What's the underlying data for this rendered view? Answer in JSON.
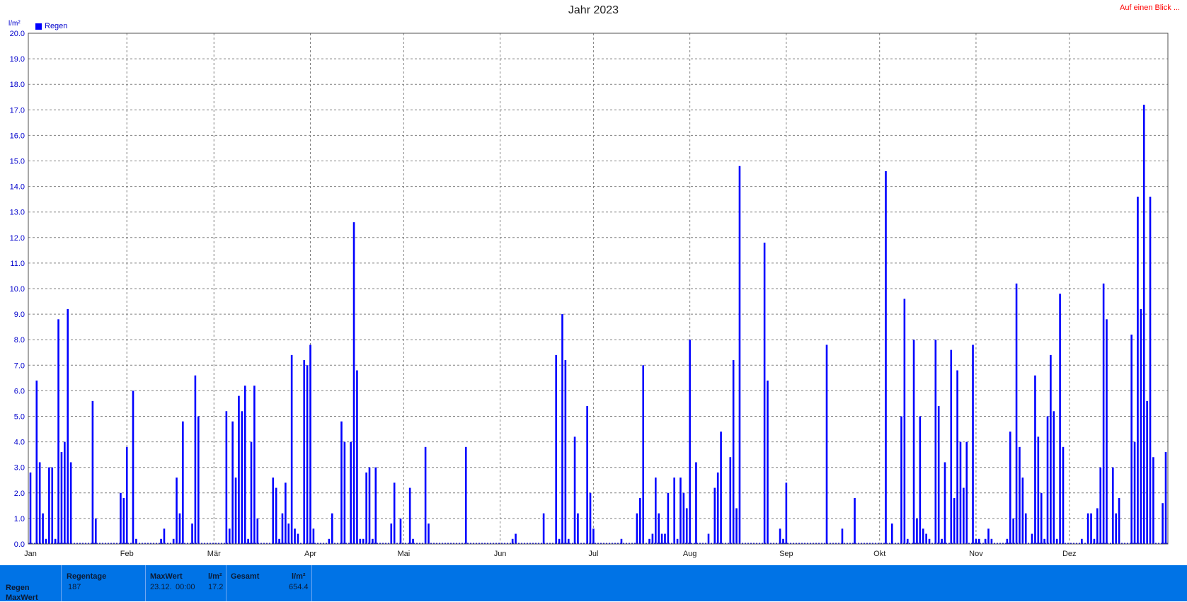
{
  "title": "Jahr 2023",
  "top_link": "Auf einen Blick ...",
  "legend_label": "Regen",
  "y_unit": "l/m²",
  "colors": {
    "bar": "#0000ff",
    "axis_text": "#0000cc",
    "footer_bg": "#0073e6",
    "link": "#ff0000"
  },
  "footer": {
    "row_labels": [
      "Regen",
      "MaxWert"
    ],
    "regentage": {
      "header": "Regentage",
      "value": "187"
    },
    "maxwert": {
      "header": "MaxWert",
      "unit": "l/m²",
      "date": "23.12.",
      "time": "00:00",
      "value": "17.2"
    },
    "gesamt": {
      "header": "Gesamt",
      "unit": "l/m²",
      "value": "654.4"
    }
  },
  "chart_data": {
    "type": "bar",
    "title": "Jahr 2023",
    "ylabel": "l/m²",
    "ylim": [
      0,
      20
    ],
    "yticks": [
      "0.0",
      "1.0",
      "2.0",
      "3.0",
      "4.0",
      "5.0",
      "6.0",
      "7.0",
      "8.0",
      "9.0",
      "10.0",
      "11.0",
      "12.0",
      "13.0",
      "14.0",
      "15.0",
      "16.0",
      "17.0",
      "18.0",
      "19.0",
      "20.0"
    ],
    "xticks": [
      {
        "label": "Jan",
        "day": 1
      },
      {
        "label": "Feb",
        "day": 32
      },
      {
        "label": "Mär",
        "day": 60
      },
      {
        "label": "Apr",
        "day": 91
      },
      {
        "label": "Mai",
        "day": 121
      },
      {
        "label": "Jun",
        "day": 152
      },
      {
        "label": "Jul",
        "day": 182
      },
      {
        "label": "Aug",
        "day": 213
      },
      {
        "label": "Sep",
        "day": 244
      },
      {
        "label": "Okt",
        "day": 274
      },
      {
        "label": "Nov",
        "day": 305
      },
      {
        "label": "Dez",
        "day": 335
      }
    ],
    "x_domain": [
      1,
      366
    ],
    "grid": true,
    "legend": "top-left",
    "series": [
      {
        "name": "Regen",
        "points": [
          [
            1,
            2.8
          ],
          [
            3,
            6.4
          ],
          [
            4,
            3.2
          ],
          [
            5,
            1.2
          ],
          [
            6,
            0.2
          ],
          [
            7,
            3.0
          ],
          [
            8,
            3.0
          ],
          [
            9,
            0.2
          ],
          [
            10,
            8.8
          ],
          [
            11,
            3.6
          ],
          [
            12,
            4.0
          ],
          [
            13,
            9.2
          ],
          [
            14,
            3.2
          ],
          [
            21,
            5.6
          ],
          [
            22,
            1.0
          ],
          [
            30,
            2.0
          ],
          [
            31,
            1.8
          ],
          [
            32,
            3.8
          ],
          [
            34,
            6.0
          ],
          [
            35,
            0.2
          ],
          [
            43,
            0.2
          ],
          [
            44,
            0.6
          ],
          [
            47,
            0.2
          ],
          [
            48,
            2.6
          ],
          [
            49,
            1.2
          ],
          [
            50,
            4.8
          ],
          [
            53,
            0.8
          ],
          [
            54,
            6.6
          ],
          [
            55,
            5.0
          ],
          [
            64,
            5.2
          ],
          [
            65,
            0.6
          ],
          [
            66,
            4.8
          ],
          [
            67,
            2.6
          ],
          [
            68,
            5.8
          ],
          [
            69,
            5.2
          ],
          [
            70,
            6.2
          ],
          [
            71,
            0.2
          ],
          [
            72,
            4.0
          ],
          [
            73,
            6.2
          ],
          [
            74,
            1.0
          ],
          [
            79,
            2.6
          ],
          [
            80,
            2.2
          ],
          [
            81,
            0.2
          ],
          [
            82,
            1.2
          ],
          [
            83,
            2.4
          ],
          [
            84,
            0.8
          ],
          [
            85,
            7.4
          ],
          [
            86,
            0.6
          ],
          [
            87,
            0.4
          ],
          [
            89,
            7.2
          ],
          [
            90,
            7.0
          ],
          [
            91,
            7.8
          ],
          [
            92,
            0.6
          ],
          [
            97,
            0.2
          ],
          [
            98,
            1.2
          ],
          [
            101,
            4.8
          ],
          [
            102,
            4.0
          ],
          [
            104,
            4.0
          ],
          [
            105,
            12.6
          ],
          [
            106,
            6.8
          ],
          [
            107,
            0.2
          ],
          [
            108,
            0.2
          ],
          [
            109,
            2.8
          ],
          [
            110,
            3.0
          ],
          [
            111,
            0.2
          ],
          [
            112,
            3.0
          ],
          [
            117,
            0.8
          ],
          [
            118,
            2.4
          ],
          [
            120,
            1.0
          ],
          [
            123,
            2.2
          ],
          [
            124,
            0.2
          ],
          [
            128,
            3.8
          ],
          [
            129,
            0.8
          ],
          [
            141,
            3.8
          ],
          [
            156,
            0.2
          ],
          [
            157,
            0.4
          ],
          [
            166,
            1.2
          ],
          [
            170,
            7.4
          ],
          [
            171,
            0.2
          ],
          [
            172,
            9.0
          ],
          [
            173,
            7.2
          ],
          [
            174,
            0.2
          ],
          [
            176,
            4.2
          ],
          [
            177,
            1.2
          ],
          [
            180,
            5.4
          ],
          [
            181,
            2.0
          ],
          [
            182,
            0.6
          ],
          [
            191,
            0.2
          ],
          [
            196,
            1.2
          ],
          [
            197,
            1.8
          ],
          [
            198,
            7.0
          ],
          [
            200,
            0.2
          ],
          [
            201,
            0.4
          ],
          [
            202,
            2.6
          ],
          [
            203,
            1.2
          ],
          [
            204,
            0.4
          ],
          [
            205,
            0.4
          ],
          [
            206,
            2.0
          ],
          [
            208,
            2.6
          ],
          [
            209,
            0.2
          ],
          [
            210,
            2.6
          ],
          [
            211,
            2.0
          ],
          [
            212,
            1.4
          ],
          [
            213,
            8.0
          ],
          [
            215,
            3.2
          ],
          [
            219,
            0.4
          ],
          [
            221,
            2.2
          ],
          [
            222,
            2.8
          ],
          [
            223,
            4.4
          ],
          [
            226,
            3.4
          ],
          [
            227,
            7.2
          ],
          [
            228,
            1.4
          ],
          [
            229,
            14.8
          ],
          [
            237,
            11.8
          ],
          [
            238,
            6.4
          ],
          [
            242,
            0.6
          ],
          [
            243,
            0.2
          ],
          [
            244,
            2.4
          ],
          [
            257,
            7.8
          ],
          [
            262,
            0.6
          ],
          [
            266,
            1.8
          ],
          [
            276,
            14.6
          ],
          [
            278,
            0.8
          ],
          [
            281,
            5.0
          ],
          [
            282,
            9.6
          ],
          [
            283,
            0.2
          ],
          [
            285,
            8.0
          ],
          [
            286,
            1.0
          ],
          [
            287,
            5.0
          ],
          [
            288,
            0.6
          ],
          [
            289,
            0.4
          ],
          [
            290,
            0.2
          ],
          [
            292,
            8.0
          ],
          [
            293,
            5.4
          ],
          [
            294,
            0.2
          ],
          [
            295,
            3.2
          ],
          [
            297,
            7.6
          ],
          [
            298,
            1.8
          ],
          [
            299,
            6.8
          ],
          [
            300,
            4.0
          ],
          [
            301,
            2.2
          ],
          [
            302,
            4.0
          ],
          [
            304,
            7.8
          ],
          [
            305,
            0.2
          ],
          [
            306,
            0.2
          ],
          [
            308,
            0.2
          ],
          [
            309,
            0.6
          ],
          [
            310,
            0.2
          ],
          [
            315,
            0.2
          ],
          [
            316,
            4.4
          ],
          [
            317,
            1.0
          ],
          [
            318,
            10.2
          ],
          [
            319,
            3.8
          ],
          [
            320,
            2.6
          ],
          [
            321,
            1.2
          ],
          [
            323,
            0.4
          ],
          [
            324,
            6.6
          ],
          [
            325,
            4.2
          ],
          [
            326,
            2.0
          ],
          [
            327,
            0.2
          ],
          [
            328,
            5.0
          ],
          [
            329,
            7.4
          ],
          [
            330,
            5.2
          ],
          [
            331,
            0.2
          ],
          [
            332,
            9.8
          ],
          [
            333,
            3.8
          ],
          [
            339,
            0.2
          ],
          [
            341,
            1.2
          ],
          [
            342,
            1.2
          ],
          [
            343,
            0.2
          ],
          [
            344,
            1.4
          ],
          [
            345,
            3.0
          ],
          [
            346,
            10.2
          ],
          [
            347,
            8.8
          ],
          [
            349,
            3.0
          ],
          [
            350,
            1.2
          ],
          [
            351,
            1.8
          ],
          [
            355,
            8.2
          ],
          [
            356,
            4.0
          ],
          [
            357,
            13.6
          ],
          [
            358,
            9.2
          ],
          [
            359,
            17.2
          ],
          [
            360,
            5.6
          ],
          [
            361,
            13.6
          ],
          [
            362,
            3.4
          ],
          [
            365,
            1.6
          ],
          [
            366,
            3.6
          ]
        ]
      }
    ]
  }
}
